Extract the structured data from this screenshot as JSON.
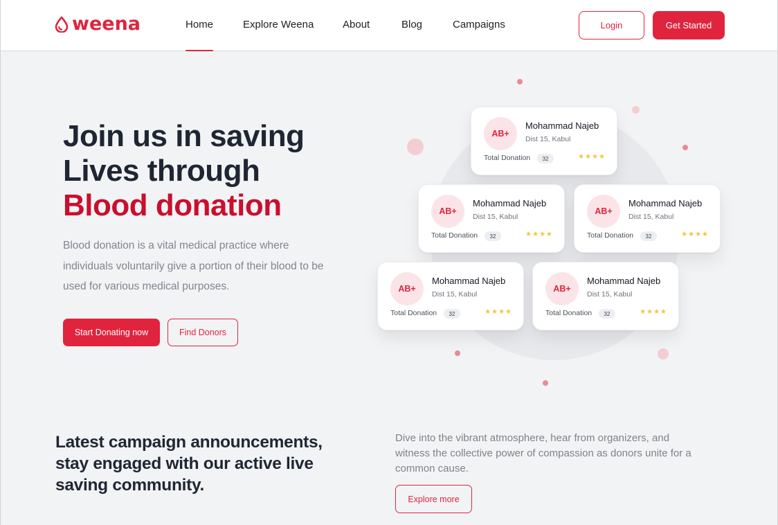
{
  "brand": {
    "name": "weena",
    "icon": "blood-drop-icon",
    "color": "#e0243d"
  },
  "nav": {
    "links": [
      "Home",
      "Explore Weena",
      "About",
      "Blog",
      "Campaigns"
    ],
    "active": "Home",
    "login_label": "Login",
    "get_started_label": "Get Started"
  },
  "hero": {
    "title_line1": "Join us in saving",
    "title_line2": "Lives through",
    "title_accent": "Blood donation",
    "description": "Blood donation is a vital medical practice where individuals voluntarily give a portion of their blood to be used for various medical purposes.",
    "primary_button": "Start Donating now",
    "secondary_button": "Find Donors"
  },
  "donor_cards": [
    {
      "blood_type": "AB+",
      "name": "Mohammad Najeb",
      "location": "Dist 15, Kabul",
      "total_label": "Total Donation",
      "count": "32",
      "rating": 4
    },
    {
      "blood_type": "AB+",
      "name": "Mohammad Najeb",
      "location": "Dist 15, Kabul",
      "total_label": "Total Donation",
      "count": "32",
      "rating": 4
    },
    {
      "blood_type": "AB+",
      "name": "Mohammad Najeb",
      "location": "Dist 15, Kabul",
      "total_label": "Total Donation",
      "count": "32",
      "rating": 4
    },
    {
      "blood_type": "AB+",
      "name": "Mohammad Najeb",
      "location": "Dist 15, Kabul",
      "total_label": "Total Donation",
      "count": "32",
      "rating": 4
    },
    {
      "blood_type": "AB+",
      "name": "Mohammad Najeb",
      "location": "Dist 15, Kabul",
      "total_label": "Total Donation",
      "count": "32",
      "rating": 4
    }
  ],
  "campaign": {
    "title": "Latest campaign announcements, stay engaged with our active live saving community.",
    "description": "Dive into the vibrant atmosphere, hear from organizers, and witness the collective power of compassion as donors unite for a common cause.",
    "button": "Explore more"
  },
  "colors": {
    "accent": "#e0243d",
    "accent_dark": "#c8102e",
    "star": "#f3c441",
    "background": "#f2f3f5"
  }
}
